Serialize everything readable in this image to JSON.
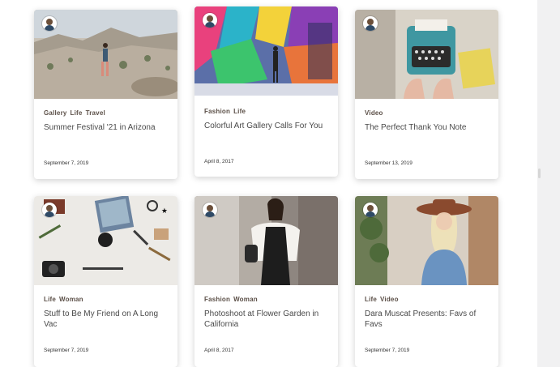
{
  "cards": [
    {
      "tags": [
        "Gallery",
        "Life",
        "Travel"
      ],
      "title": "Summer Festival '21 in Arizona",
      "date": "September 7, 2019"
    },
    {
      "tags": [
        "Fashion",
        "Life"
      ],
      "title": "Colorful Art Gallery Calls For You",
      "date": "April 8, 2017"
    },
    {
      "tags": [
        "Video"
      ],
      "title": "The Perfect Thank You Note",
      "date": "September 13, 2019"
    },
    {
      "tags": [
        "Life",
        "Woman"
      ],
      "title": "Stuff to Be My Friend on A Long Vac",
      "date": "September 7, 2019"
    },
    {
      "tags": [
        "Fashion",
        "Woman"
      ],
      "title": "Photoshoot at Flower Garden in California",
      "date": "April 8, 2017"
    },
    {
      "tags": [
        "Life",
        "Video"
      ],
      "title": "Dara Muscat Presents: Favs of Favs",
      "date": "September 7, 2019"
    }
  ],
  "icons": {
    "avatar": "author-avatar-icon",
    "featured": "star-icon"
  }
}
